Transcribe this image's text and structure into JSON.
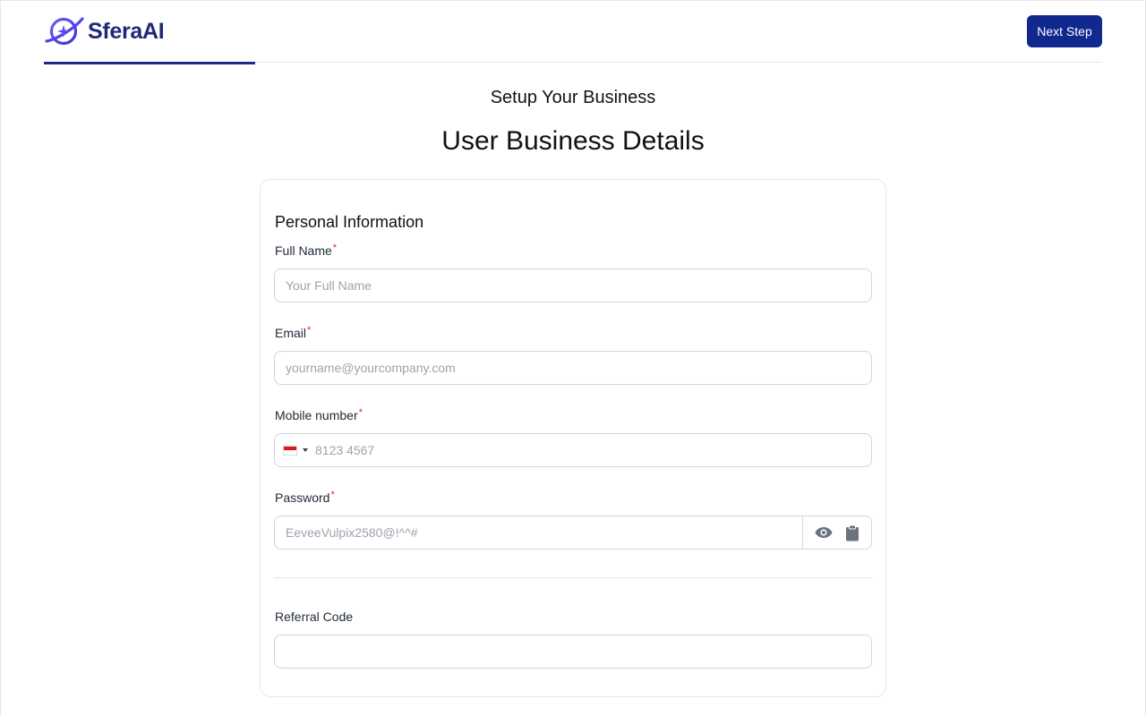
{
  "brand": {
    "name": "SferaAI",
    "color": "#1e2a78"
  },
  "header": {
    "next_button": "Next Step",
    "accent": "#11288f"
  },
  "page": {
    "subtitle": "Setup Your Business",
    "title": "User Business Details"
  },
  "form": {
    "section_title": "Personal Information",
    "full_name": {
      "label": "Full Name",
      "required": "*",
      "placeholder": "Your Full Name",
      "value": ""
    },
    "email": {
      "label": "Email",
      "required": "*",
      "placeholder": "yourname@yourcompany.com",
      "value": ""
    },
    "mobile": {
      "label": "Mobile number",
      "required": "*",
      "country_flag": "singapore-flag-icon",
      "placeholder": "8123 4567",
      "value": ""
    },
    "password": {
      "label": "Password",
      "required": "*",
      "placeholder": "EeveeVulpix2580@!^^#",
      "value": "",
      "icons": [
        "eye-icon",
        "clipboard-icon"
      ]
    },
    "referral": {
      "label": "Referral Code",
      "placeholder": "",
      "value": ""
    }
  }
}
